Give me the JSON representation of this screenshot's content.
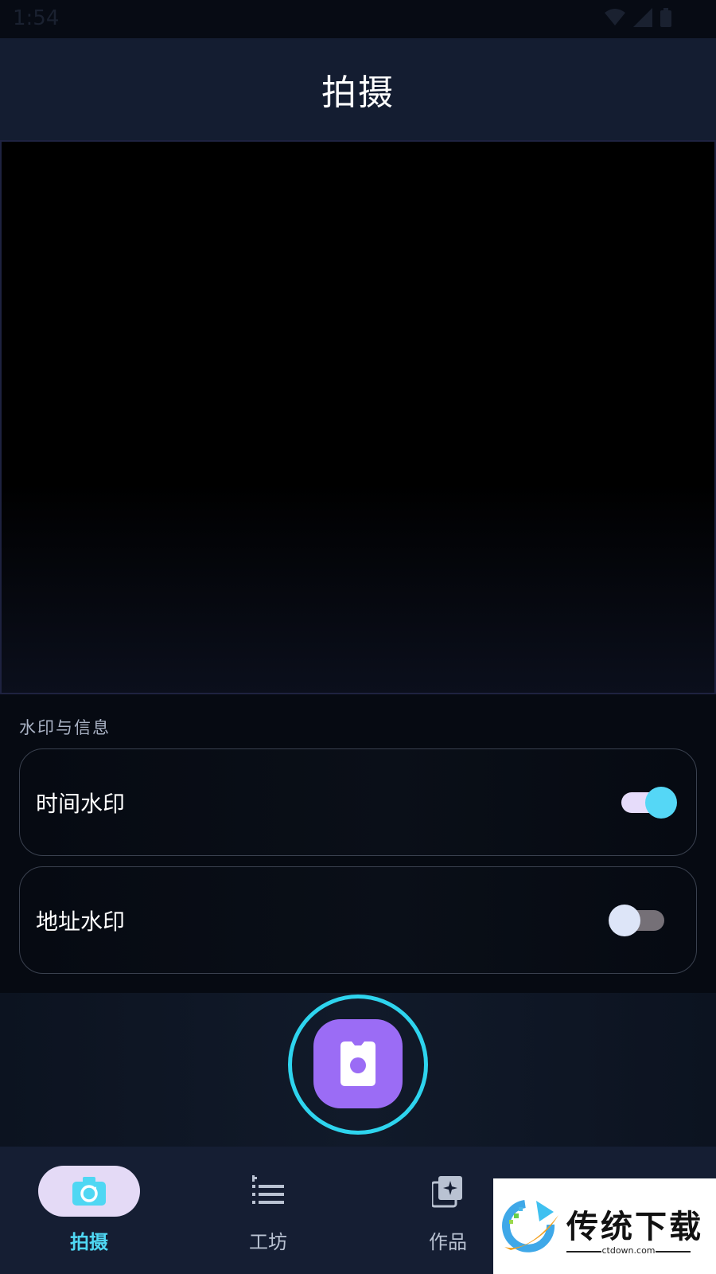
{
  "status": {
    "time": "1:54"
  },
  "header": {
    "title": "拍摄"
  },
  "settings": {
    "section_label": "水印与信息",
    "items": [
      {
        "label": "时间水印",
        "enabled": true
      },
      {
        "label": "地址水印",
        "enabled": false
      }
    ]
  },
  "nav": {
    "items": [
      {
        "label": "拍摄",
        "icon": "camera-icon",
        "active": true
      },
      {
        "label": "工坊",
        "icon": "list-icon",
        "active": false
      },
      {
        "label": "作品",
        "icon": "gallery-icon",
        "active": false
      }
    ]
  },
  "watermark": {
    "title": "传统下载",
    "subtitle": "ctdown.com"
  },
  "colors": {
    "accent": "#4fd7f3",
    "shutter": "#9b6cf5",
    "header_bg": "#141d31",
    "nav_active_pill": "#e4daf6"
  }
}
